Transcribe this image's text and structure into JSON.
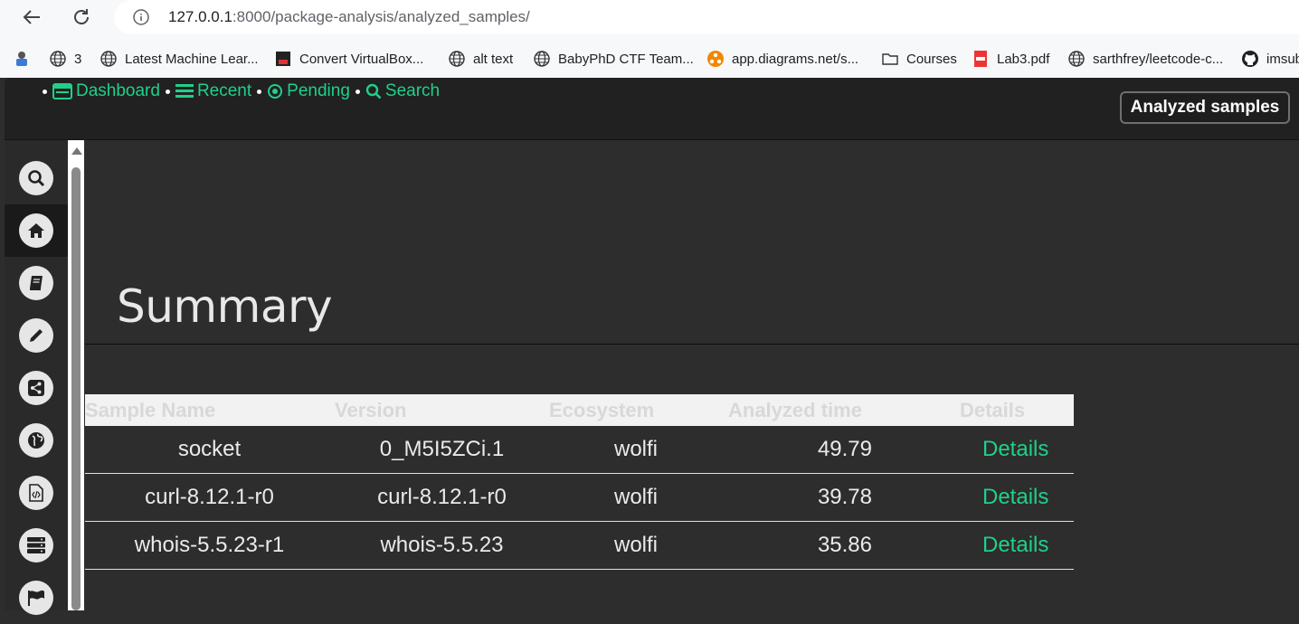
{
  "browser": {
    "url_host": "127.0.0.1",
    "url_path": ":8000/package-analysis/analyzed_samples/",
    "bookmarks": [
      {
        "label": "3",
        "icon": "globe-icon"
      },
      {
        "label": "Latest Machine Lear...",
        "icon": "globe-icon"
      },
      {
        "label": "Convert VirtualBox...",
        "icon": "site-icon"
      },
      {
        "label": "alt text",
        "icon": "globe-icon"
      },
      {
        "label": "BabyPhD CTF Team...",
        "icon": "globe-icon"
      },
      {
        "label": "app.diagrams.net/s...",
        "icon": "diagrams-icon"
      },
      {
        "label": "Courses",
        "icon": "folder-icon"
      },
      {
        "label": "Lab3.pdf",
        "icon": "pdf-icon"
      },
      {
        "label": "sarthfrey/leetcode-c...",
        "icon": "globe-icon"
      },
      {
        "label": "imsub",
        "icon": "github-icon"
      }
    ]
  },
  "header": {
    "nav": [
      {
        "label": "Dashboard",
        "icon": "dashboard-icon"
      },
      {
        "label": "Recent",
        "icon": "list-icon"
      },
      {
        "label": "Pending",
        "icon": "dot-circle-icon"
      },
      {
        "label": "Search",
        "icon": "search-icon"
      }
    ],
    "button_label": "Analyzed samples"
  },
  "sidebar": {
    "items": [
      {
        "icon": "search-icon"
      },
      {
        "icon": "home-icon",
        "active": true
      },
      {
        "icon": "book-icon"
      },
      {
        "icon": "pencil-icon"
      },
      {
        "icon": "share-icon"
      },
      {
        "icon": "globe-icon"
      },
      {
        "icon": "code-file-icon"
      },
      {
        "icon": "server-icon"
      },
      {
        "icon": "flag-icon"
      }
    ]
  },
  "main": {
    "title": "Summary",
    "table": {
      "headers": [
        "Sample Name",
        "Version",
        "Ecosystem",
        "Analyzed time",
        "Details"
      ],
      "rows": [
        {
          "name": "socket",
          "version": "0_M5I5ZCi.1",
          "ecosystem": "wolfi",
          "time": "49.79",
          "details": "Details"
        },
        {
          "name": "curl-8.12.1-r0",
          "version": "curl-8.12.1-r0",
          "ecosystem": "wolfi",
          "time": "39.78",
          "details": "Details"
        },
        {
          "name": "whois-5.5.23-r1",
          "version": "whois-5.5.23",
          "ecosystem": "wolfi",
          "time": "35.86",
          "details": "Details"
        }
      ]
    }
  },
  "colors": {
    "accent": "#1fd08a",
    "header_bg": "#212121",
    "page_bg": "#2d2d2d"
  }
}
